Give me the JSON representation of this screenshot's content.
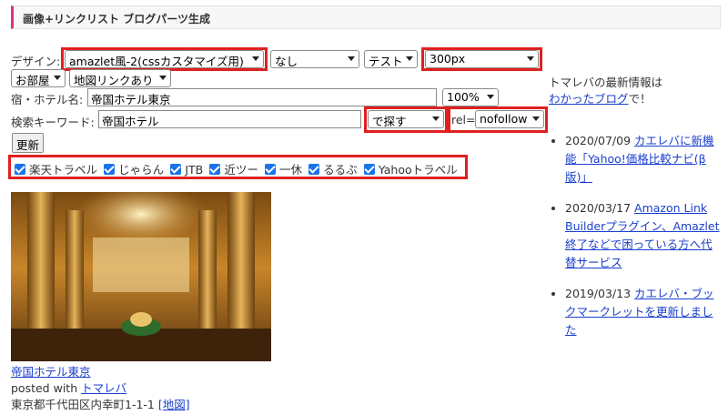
{
  "header": {
    "title": "画像+リンクリスト ブログパーツ生成"
  },
  "form": {
    "design_label": "デザイン:",
    "design_select": "amazlet風-2(cssカスタマイズ用)",
    "none_select": "なし",
    "test_select": "テスト",
    "width_select": "300px",
    "room_select": "お部屋",
    "map_select": "地図リンクあり",
    "hotel_label": "宿・ホテル名:",
    "hotel_value": "帝国ホテル東京",
    "percent_select": "100%",
    "keyword_label": "検索キーワード:",
    "keyword_value": "帝国ホテル",
    "search_select": "で探す",
    "rel_label": "rel=",
    "rel_select": "nofollow",
    "update_button": "更新"
  },
  "sites": [
    {
      "label": "楽天トラベル",
      "checked": true
    },
    {
      "label": "じゃらん",
      "checked": true
    },
    {
      "label": "JTB",
      "checked": true
    },
    {
      "label": "近ツー",
      "checked": true
    },
    {
      "label": "一休",
      "checked": true
    },
    {
      "label": "るるぶ",
      "checked": true
    },
    {
      "label": "Yahooトラベル",
      "checked": true
    }
  ],
  "preview": {
    "hotel_link": "帝国ホテル東京",
    "posted_with": "posted with",
    "posted_link": "トマレバ",
    "address": "東京都千代田区内幸町1-1-1",
    "map_link": "[地図]"
  },
  "sidebar": {
    "intro": "トマレバの最新情報は",
    "blog_link": "わかったブログ",
    "intro_suffix": "で！",
    "news": [
      {
        "date": "2020/07/09",
        "title": "カエレバに新機能「Yahoo!価格比較ナビ(β版)」"
      },
      {
        "date": "2020/03/17",
        "title": "Amazon Link Builderプラグイン、Amazlet終了などで困っている方へ代替サービス"
      },
      {
        "date": "2019/03/13",
        "title": "カエレバ・ブックマークレットを更新しました"
      }
    ]
  },
  "colors": {
    "accent": "#e0307a",
    "highlight": "#e02020",
    "link": "#1a3fcc",
    "checkbox": "#1a73e8"
  }
}
